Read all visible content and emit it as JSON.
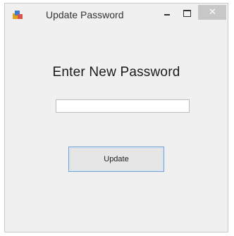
{
  "window": {
    "title": "Update Password",
    "close_glyph": "✕",
    "icons": {
      "app": "app-icon",
      "minimize": "minimize-icon",
      "maximize": "maximize-icon",
      "close": "close-icon"
    }
  },
  "form": {
    "heading": "Enter New Password",
    "password_value": "",
    "update_label": "Update"
  },
  "colors": {
    "window_background": "#f0f0f0",
    "close_button": "#c7c7c7",
    "button_focus_border": "#6fa3d8"
  }
}
